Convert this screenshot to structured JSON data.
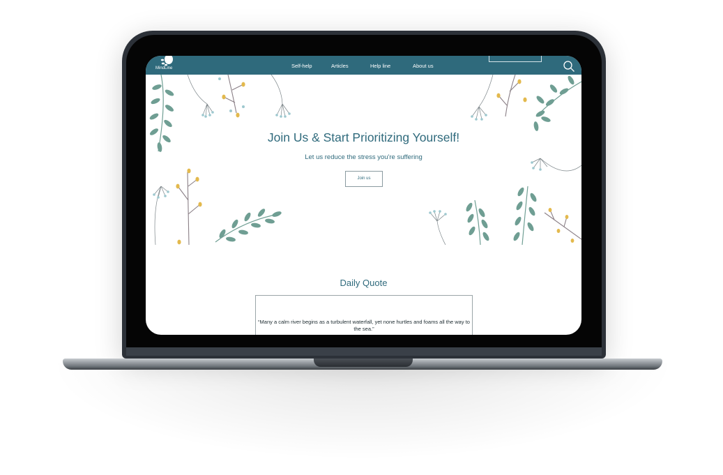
{
  "app": {
    "logo_text": "MindLine"
  },
  "nav": {
    "items": [
      "Self-help",
      "Articles",
      "Help line",
      "About us"
    ]
  },
  "hero": {
    "title": "Join Us & Start Prioritizing Yourself!",
    "subtitle": "Let us reduce the stress you're suffering",
    "button_label": "Join us"
  },
  "quote": {
    "heading": "Daily Quote",
    "text": "“Many a calm river begins as a turbulent waterfall, yet none hurtles and foams all the way to the sea.”"
  },
  "colors": {
    "brand": "#2f6a7c",
    "leaf": "#6f9e93",
    "berry": "#e3b94d",
    "bud": "#9dc8cf",
    "stem": "#8a7f86"
  },
  "icons": {
    "search": "search-icon",
    "logo": "leaf-logo-icon"
  }
}
